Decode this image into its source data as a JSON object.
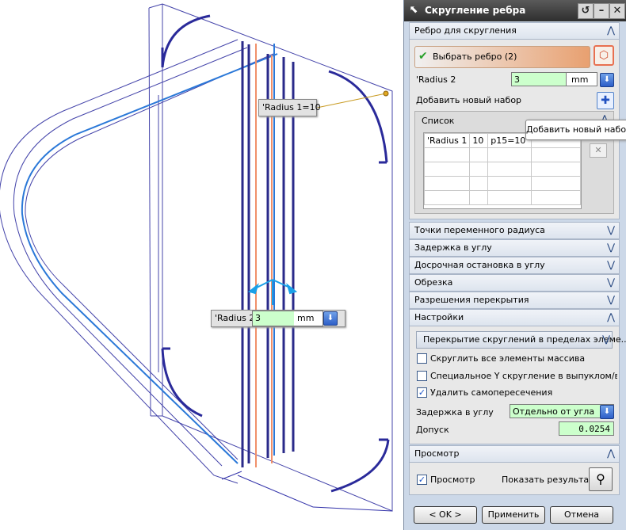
{
  "viewport": {
    "radius1_label": "'Radius 1=10",
    "radius2_label": "'Radius 2",
    "radius2_value": "3",
    "radius2_unit": "mm"
  },
  "dialog": {
    "title": "Скругление ребра",
    "sections": {
      "edge": "Ребро для скругления",
      "var_radius": "Точки переменного радиуса",
      "corner_setback": "Задержка в углу",
      "corner_stop": "Досрочная остановка в углу",
      "trim": "Обрезка",
      "overflow": "Разрешения перекрытия",
      "settings": "Настройки",
      "preview": "Просмотр"
    },
    "edge": {
      "select_label": "Выбрать ребро (2)",
      "radius_label": "'Radius 2",
      "radius_value": "3",
      "radius_unit": "mm",
      "add_set_label": "Добавить новый набор",
      "tooltip": "Добавить новый набор",
      "list_header": "Список",
      "list_rows": [
        [
          "'Radius 1",
          "10",
          "p15=10",
          ""
        ],
        [
          "",
          "",
          "",
          ""
        ],
        [
          "",
          "",
          "",
          ""
        ],
        [
          "",
          "",
          "",
          ""
        ],
        [
          "",
          "",
          "",
          ""
        ]
      ]
    },
    "settings": {
      "blend_overlap_select": "Перекрытие скруглений в пределах элеме...",
      "opt_blend_all": "Скруглить все элементы массива",
      "opt_special_y": "Специальное Y скругление в выпуклом/вогну",
      "opt_remove_self": "Удалить самопересечения",
      "corner_setback_label": "Задержка в углу",
      "corner_setback_value": "Отдельно от угла",
      "tolerance_label": "Допуск",
      "tolerance_value": "0.0254"
    },
    "preview": {
      "preview_label": "Просмотр",
      "show_result_label": "Показать результат"
    },
    "buttons": {
      "ok": "< OK >",
      "apply": "Применить",
      "cancel": "Отмена"
    },
    "colors": {
      "accent_bar": "#e8a070",
      "field_green": "#ccffcc",
      "section_bg": "#dde4ee",
      "panel_bg": "#ccd8e8"
    }
  }
}
